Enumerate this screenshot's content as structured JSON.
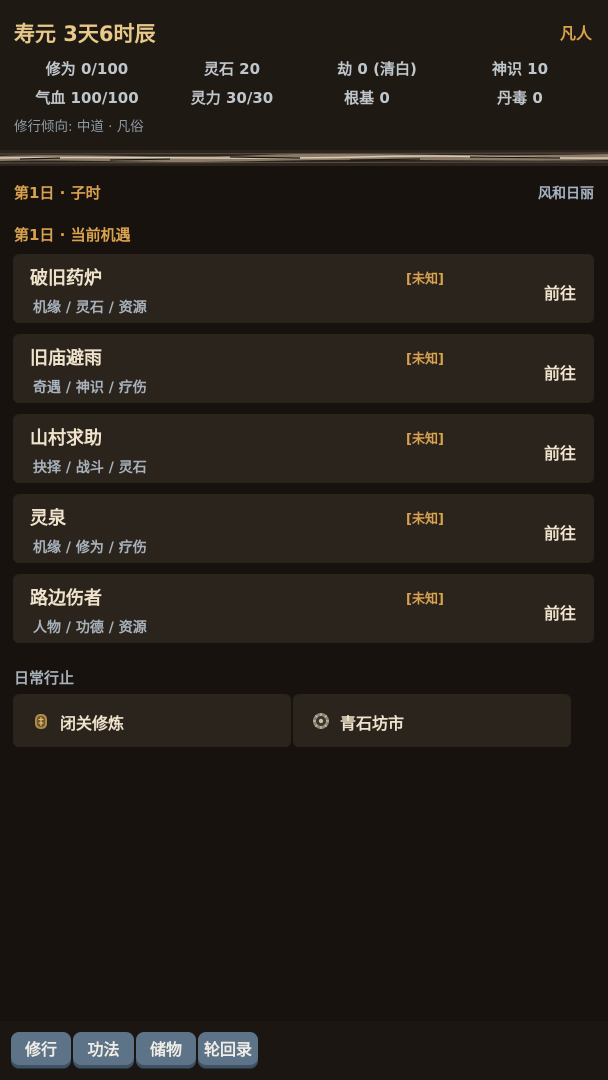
{
  "header": {
    "lifespan": "寿元 3天6时辰",
    "rank": "凡人",
    "stats_row1": [
      "修为 0/100",
      "灵石 20",
      "劫 0 (清白)",
      "神识 10"
    ],
    "stats_row2": [
      "气血 100/100",
      "灵力 30/30",
      "根基 0",
      "丹毒 0"
    ],
    "tendency": "修行倾向: 中道 · 凡俗"
  },
  "status": {
    "day": "第1日 · 子时",
    "weather": "风和日丽"
  },
  "opportunities": {
    "title": "第1日 · 当前机遇",
    "items": [
      {
        "name": "破旧药炉",
        "tags": "机缘 / 灵石 / 资源",
        "status": "[未知]",
        "action": "前往"
      },
      {
        "name": "旧庙避雨",
        "tags": "奇遇 / 神识 / 疗伤",
        "status": "[未知]",
        "action": "前往"
      },
      {
        "name": "山村求助",
        "tags": "抉择 / 战斗 / 灵石",
        "status": "[未知]",
        "action": "前往"
      },
      {
        "name": "灵泉",
        "tags": "机缘 / 修为 / 疗伤",
        "status": "[未知]",
        "action": "前往"
      },
      {
        "name": "路边伤者",
        "tags": "人物 / 功德 / 资源",
        "status": "[未知]",
        "action": "前往"
      }
    ]
  },
  "daily": {
    "title": "日常行止",
    "items": [
      {
        "label": "闭关修炼",
        "icon": "meditation-icon"
      },
      {
        "label": "青石坊市",
        "icon": "market-icon"
      }
    ]
  },
  "nav": {
    "tabs": [
      "修行",
      "功法",
      "储物",
      "轮回录"
    ]
  },
  "colors": {
    "accent": "#d9a24f",
    "title": "#e8c98a",
    "button": "#5c7388",
    "card": "#2b241d"
  }
}
